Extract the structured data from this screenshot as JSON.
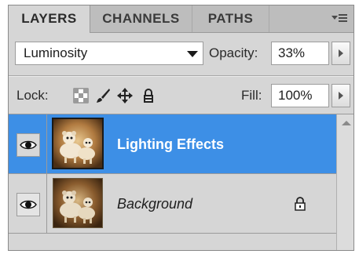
{
  "tabs": [
    {
      "label": "LAYERS",
      "active": true
    },
    {
      "label": "CHANNELS",
      "active": false
    },
    {
      "label": "PATHS",
      "active": false
    }
  ],
  "panel_menu_icon": "panel-menu-icon",
  "blend": {
    "mode": "Luminosity"
  },
  "opacity": {
    "label": "Opacity:",
    "value": "33%"
  },
  "lock": {
    "label": "Lock:",
    "icons": [
      "lock-transparent-pixels-icon",
      "lock-image-pixels-icon",
      "lock-position-icon",
      "lock-all-icon"
    ]
  },
  "fill": {
    "label": "Fill:",
    "value": "100%"
  },
  "layers": [
    {
      "name": "Lighting Effects",
      "selected": true,
      "visible": true,
      "locked": false
    },
    {
      "name": "Background",
      "selected": false,
      "visible": true,
      "locked": true
    }
  ],
  "colors": {
    "selection": "#3d8fe6",
    "panel": "#d6d6d6",
    "tabbar": "#bdbdbd"
  }
}
